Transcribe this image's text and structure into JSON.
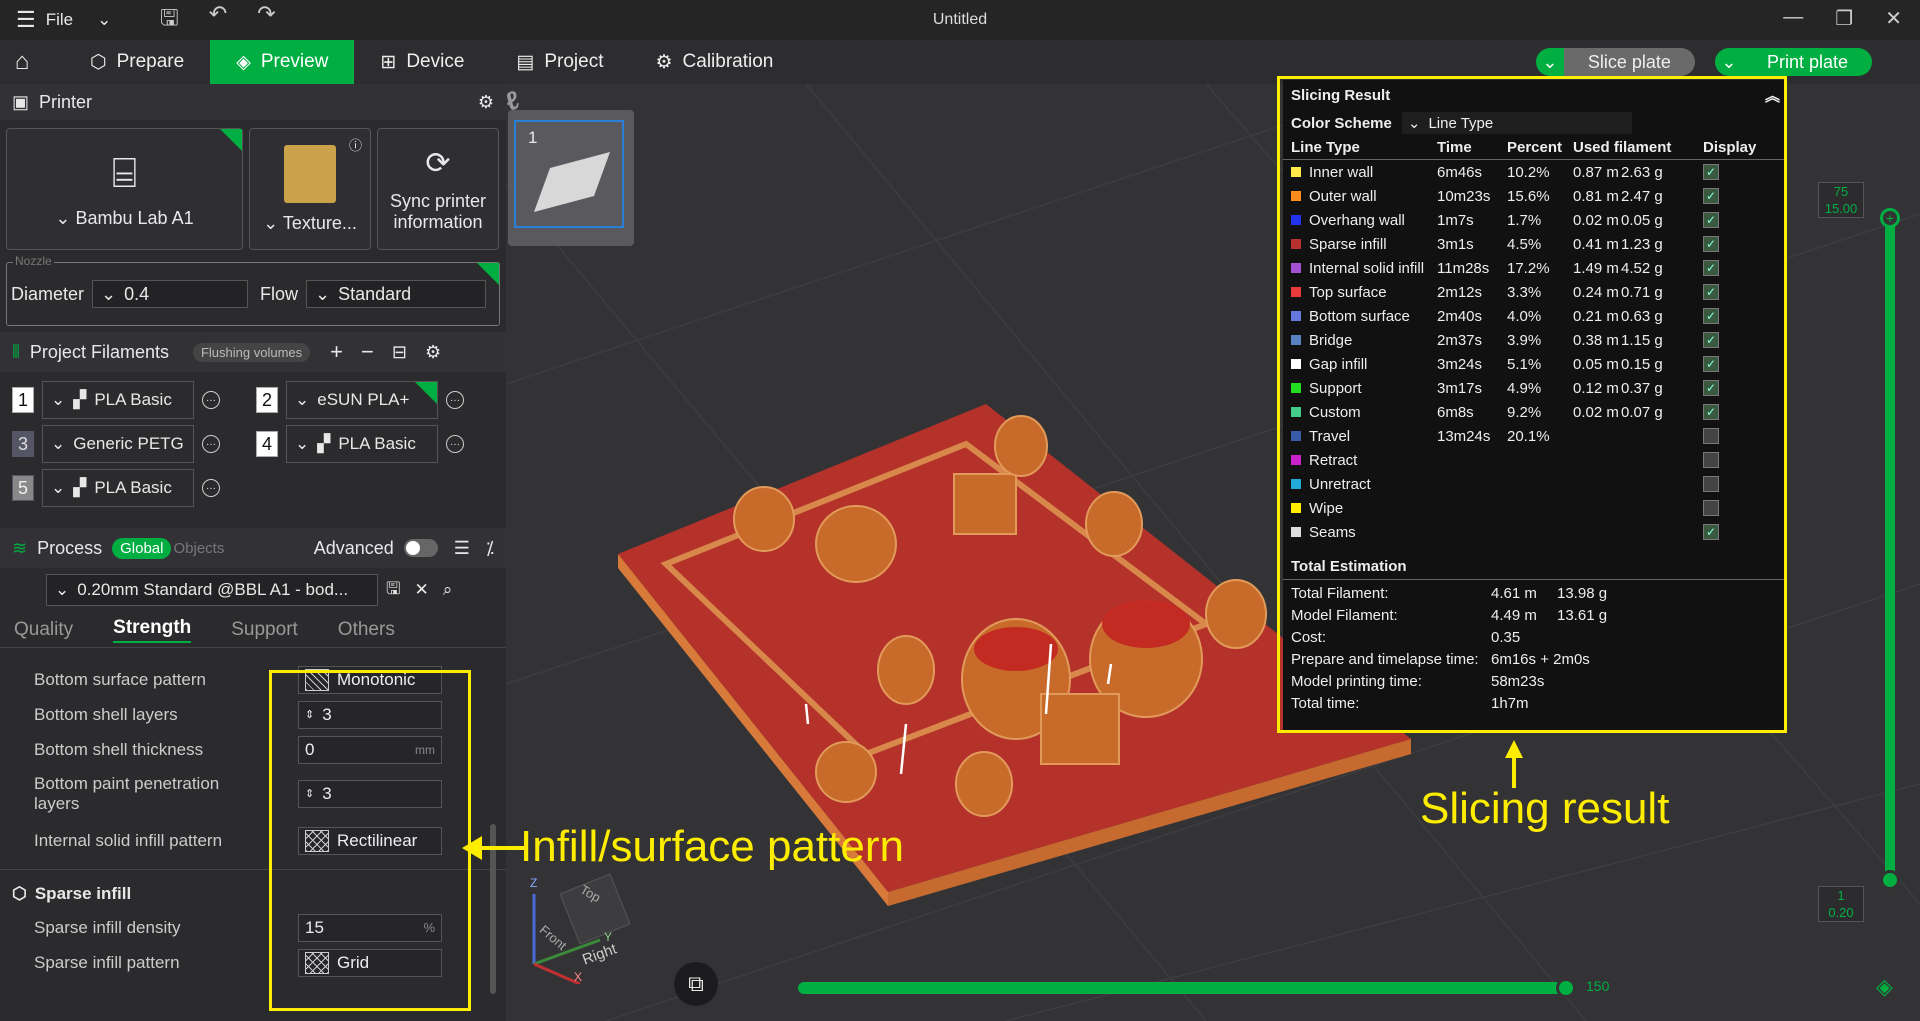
{
  "titlebar": {
    "file": "File",
    "title": "Untitled"
  },
  "tabs": [
    "Prepare",
    "Preview",
    "Device",
    "Project",
    "Calibration"
  ],
  "actions": {
    "slice": "Slice plate",
    "print": "Print plate"
  },
  "printer": {
    "header": "Printer",
    "model": "Bambu Lab A1",
    "plate": "Texture...",
    "sync": "Sync printer information"
  },
  "nozzle": {
    "legend": "Nozzle",
    "diameter_label": "Diameter",
    "diameter": "0.4",
    "flow_label": "Flow",
    "flow": "Standard"
  },
  "filaments": {
    "header": "Project Filaments",
    "flushing": "Flushing volumes",
    "items": [
      {
        "n": "1",
        "name": "PLA Basic"
      },
      {
        "n": "2",
        "name": "eSUN PLA+"
      },
      {
        "n": "3",
        "name": "Generic PETG"
      },
      {
        "n": "4",
        "name": "PLA Basic"
      },
      {
        "n": "5",
        "name": "PLA Basic"
      }
    ]
  },
  "process": {
    "header": "Process",
    "global": "Global",
    "objects": "Objects",
    "advanced": "Advanced",
    "preset": "0.20mm Standard @BBL A1 - bod...",
    "subtabs": [
      "Quality",
      "Strength",
      "Support",
      "Others"
    ]
  },
  "settings": [
    {
      "label": "Bottom surface pattern",
      "value": "Monotonic"
    },
    {
      "label": "Bottom shell layers",
      "value": "3"
    },
    {
      "label": "Bottom shell thickness",
      "value": "0",
      "unit": "mm"
    },
    {
      "label": "Bottom paint penetration layers",
      "value": "3"
    },
    {
      "label": "Internal solid infill pattern",
      "value": "Rectilinear"
    },
    {
      "label": "Sparse infill density",
      "value": "15",
      "unit": "%"
    },
    {
      "label": "Sparse infill pattern",
      "value": "Grid"
    }
  ],
  "sparse_header": "Sparse infill",
  "plate_number": "1",
  "slider": {
    "top_layer": "75",
    "top_height": "15.00",
    "bottom_layer": "1",
    "bottom_height": "0.20",
    "h_value": "150"
  },
  "result": {
    "title": "Slicing Result",
    "scheme_label": "Color Scheme",
    "scheme": "Line Type",
    "headers": [
      "Line Type",
      "Time",
      "Percent",
      "Used filament",
      "Display"
    ],
    "rows": [
      {
        "name": "Inner wall",
        "color": "#ffe94d",
        "time": "6m46s",
        "pct": "10.2%",
        "len": "0.87 m",
        "g": "2.63 g",
        "on": true
      },
      {
        "name": "Outer wall",
        "color": "#ff8c1a",
        "time": "10m23s",
        "pct": "15.6%",
        "len": "0.81 m",
        "g": "2.47 g",
        "on": true
      },
      {
        "name": "Overhang wall",
        "color": "#2233ee",
        "time": "1m7s",
        "pct": "1.7%",
        "len": "0.02 m",
        "g": "0.05 g",
        "on": true
      },
      {
        "name": "Sparse infill",
        "color": "#b8302e",
        "time": "3m1s",
        "pct": "4.5%",
        "len": "0.41 m",
        "g": "1.23 g",
        "on": true
      },
      {
        "name": "Internal solid infill",
        "color": "#a050d0",
        "time": "11m28s",
        "pct": "17.2%",
        "len": "1.49 m",
        "g": "4.52 g",
        "on": true
      },
      {
        "name": "Top surface",
        "color": "#e83c3c",
        "time": "2m12s",
        "pct": "3.3%",
        "len": "0.24 m",
        "g": "0.71 g",
        "on": true
      },
      {
        "name": "Bottom surface",
        "color": "#6677dd",
        "time": "2m40s",
        "pct": "4.0%",
        "len": "0.21 m",
        "g": "0.63 g",
        "on": true
      },
      {
        "name": "Bridge",
        "color": "#5a82c0",
        "time": "2m37s",
        "pct": "3.9%",
        "len": "0.38 m",
        "g": "1.15 g",
        "on": true
      },
      {
        "name": "Gap infill",
        "color": "#ffffff",
        "time": "3m24s",
        "pct": "5.1%",
        "len": "0.05 m",
        "g": "0.15 g",
        "on": true
      },
      {
        "name": "Support",
        "color": "#22dd22",
        "time": "3m17s",
        "pct": "4.9%",
        "len": "0.12 m",
        "g": "0.37 g",
        "on": true
      },
      {
        "name": "Custom",
        "color": "#44cc88",
        "time": "6m8s",
        "pct": "9.2%",
        "len": "0.02 m",
        "g": "0.07 g",
        "on": true
      },
      {
        "name": "Travel",
        "color": "#3a5aaa",
        "time": "13m24s",
        "pct": "20.1%",
        "len": "",
        "g": "",
        "on": false
      },
      {
        "name": "Retract",
        "color": "#cc22cc",
        "time": "",
        "pct": "",
        "len": "",
        "g": "",
        "on": false
      },
      {
        "name": "Unretract",
        "color": "#22aadd",
        "time": "",
        "pct": "",
        "len": "",
        "g": "",
        "on": false
      },
      {
        "name": "Wipe",
        "color": "#ffee00",
        "time": "",
        "pct": "",
        "len": "",
        "g": "",
        "on": false
      },
      {
        "name": "Seams",
        "color": "#dddddd",
        "time": "",
        "pct": "",
        "len": "",
        "g": "",
        "on": true
      }
    ],
    "total_title": "Total Estimation",
    "totals": [
      {
        "k": "Total Filament:",
        "v": "4.61 m",
        "v2": "13.98 g"
      },
      {
        "k": "Model Filament:",
        "v": "4.49 m",
        "v2": "13.61 g"
      },
      {
        "k": "Cost:",
        "v": "0.35",
        "v2": ""
      },
      {
        "k": "Prepare and timelapse time:",
        "v": "6m16s + 2m0s",
        "v2": ""
      },
      {
        "k": "Model printing time:",
        "v": "58m23s",
        "v2": ""
      },
      {
        "k": "Total time:",
        "v": "1h7m",
        "v2": ""
      }
    ]
  },
  "annotations": {
    "infill": "Infill/surface pattern",
    "result": "Slicing result"
  },
  "axes": {
    "top": "Top",
    "front": "Front",
    "right": "Right",
    "z": "Z",
    "y": "Y",
    "x": "X"
  }
}
